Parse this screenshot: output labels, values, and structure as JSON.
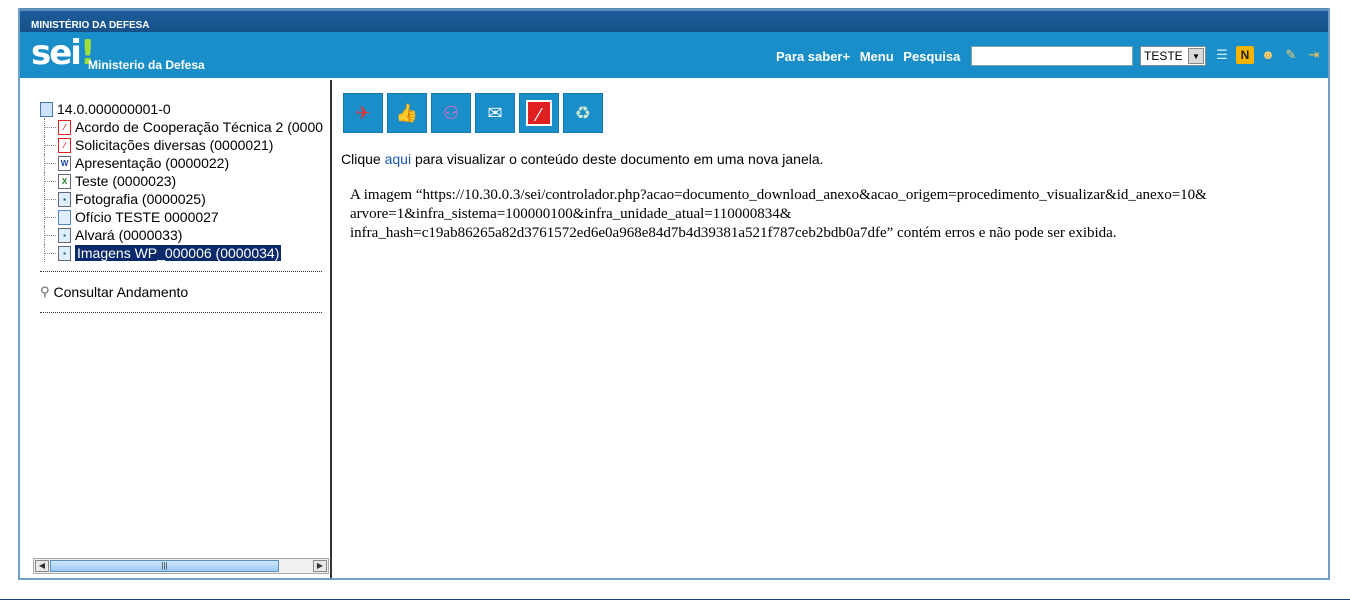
{
  "header": {
    "ministry": "MINISTÉRIO DA DEFESA",
    "logo": "sei",
    "logo_dot": "!",
    "org_name": "Ministerio da Defesa",
    "links": [
      "Para saber+",
      "Menu",
      "Pesquisa"
    ],
    "search_value": "",
    "unit_selected": "TESTE",
    "icons": [
      "list-icon",
      "notes-icon",
      "user-icon",
      "tools-icon",
      "logout-icon"
    ]
  },
  "tree": {
    "root": "14.0.000000001-0",
    "items": [
      {
        "label": "Acordo de Cooperação Técnica 2 (0000",
        "icon": "pdf-icon"
      },
      {
        "label": "Solicitações diversas (0000021)",
        "icon": "pdf-icon"
      },
      {
        "label": "Apresentação (0000022)",
        "icon": "word-icon"
      },
      {
        "label": "Teste (0000023)",
        "icon": "excel-icon"
      },
      {
        "label": "Fotografia (0000025)",
        "icon": "image-icon"
      },
      {
        "label": "Ofício TESTE 0000027",
        "icon": "document-icon"
      },
      {
        "label": "Alvará (0000033)",
        "icon": "image-icon"
      },
      {
        "label": "Imagens WP_000006 (0000034)",
        "icon": "image-icon",
        "selected": true
      }
    ],
    "consult": "Consultar Andamento"
  },
  "toolbar": [
    "bird-computer-icon",
    "thumbs-up-icon",
    "people-icon",
    "email-icon",
    "cancel-icon",
    "recycle-icon"
  ],
  "content": {
    "clique_prefix": "Clique ",
    "clique_link": "aqui",
    "clique_suffix": " para visualizar o conteúdo deste documento em uma nova janela.",
    "message_line1": "A imagem “https://10.30.0.3/sei/controlador.php?acao=documento_download_anexo&acao_origem=procedimento_visualizar&id_anexo=10&",
    "message_line2": "arvore=1&infra_sistema=100000100&infra_unidade_atual=110000834&",
    "message_line3": "infra_hash=c19ab86265a82d3761572ed6e0a968e84d7b4d39381a521f787ceb2bdb0a7dfe” contém erros e não pode ser exibida."
  }
}
